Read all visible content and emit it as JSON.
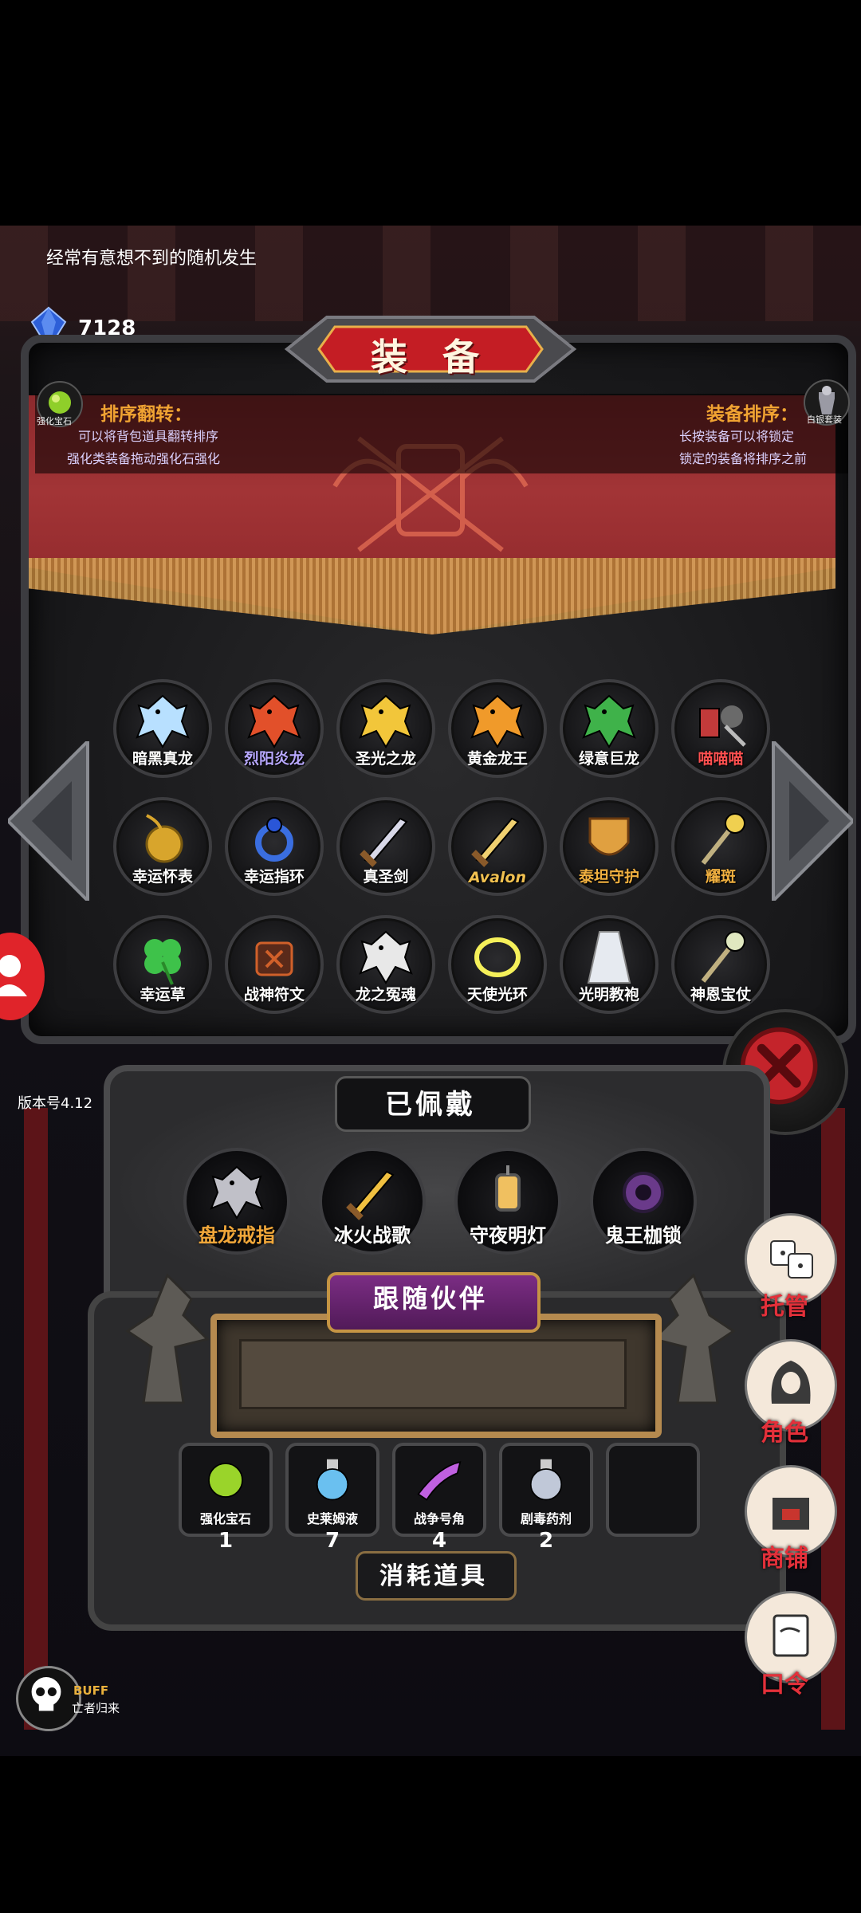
{
  "tip": "经常有意想不到的随机发生",
  "currency": {
    "value": "7128",
    "caption": "宝石"
  },
  "title": "装 备",
  "info": {
    "left_title": "排序翻转：",
    "left_line1": "可以将背包道具翻转排序",
    "left_line2": "强化类装备拖动强化石强化",
    "right_title": "装备排序：",
    "right_line1": "长按装备可以将锁定",
    "right_line2": "锁定的装备将排序之前",
    "left_icon_caption": "强化宝石",
    "right_icon_caption": "白银套装"
  },
  "equipment": [
    {
      "label": "暗黑真龙",
      "icon": "ice-dragon-icon",
      "color": "#b8e0ff"
    },
    {
      "label": "烈阳炎龙",
      "icon": "fire-dragon-icon",
      "color": "#e2502a"
    },
    {
      "label": "圣光之龙",
      "icon": "holy-dragon-icon",
      "color": "#f2c63a"
    },
    {
      "label": "黄金龙王",
      "icon": "gold-dragon-icon",
      "color": "#f09a2a"
    },
    {
      "label": "绿意巨龙",
      "icon": "green-dragon-icon",
      "color": "#3fb24a"
    },
    {
      "label": "喵喵喵",
      "icon": "cat-warrior-icon",
      "color": "#c23a3a"
    },
    {
      "label": "幸运怀表",
      "icon": "pocket-watch-icon",
      "color": "#d8a52c"
    },
    {
      "label": "幸运指环",
      "icon": "ring-icon",
      "color": "#3a6ee0"
    },
    {
      "label": "真圣剑",
      "icon": "holy-sword-icon",
      "color": "#d8d8e8"
    },
    {
      "label": "Avalon",
      "icon": "avalon-sheath-icon",
      "color": "#f0d070"
    },
    {
      "label": "泰坦守护",
      "icon": "titan-shield-icon",
      "color": "#e0a040"
    },
    {
      "label": "耀斑",
      "icon": "flare-mace-icon",
      "color": "#f0d050"
    },
    {
      "label": "幸运草",
      "icon": "clover-icon",
      "color": "#3ec24a"
    },
    {
      "label": "战神符文",
      "icon": "rune-icon",
      "color": "#d0602a"
    },
    {
      "label": "龙之冤魂",
      "icon": "dragon-wraith-icon",
      "color": "#e8e8e8"
    },
    {
      "label": "天使光环",
      "icon": "halo-icon",
      "color": "#f5f05a"
    },
    {
      "label": "光明教袍",
      "icon": "robe-icon",
      "color": "#e6eaf0"
    },
    {
      "label": "神恩宝仗",
      "icon": "holy-staff-icon",
      "color": "#e0e8c0"
    }
  ],
  "worn": {
    "title": "已佩戴",
    "items": [
      {
        "label": "盘龙戒指",
        "icon": "dragon-ring-icon",
        "color": "#c0c0c8",
        "label_color": "#f2a83a"
      },
      {
        "label": "冰火战歌",
        "icon": "ice-fire-sword-icon",
        "color": "#f0c040",
        "label_color": "#ffffff"
      },
      {
        "label": "守夜明灯",
        "icon": "lantern-icon",
        "color": "#f0c060",
        "label_color": "#ffffff"
      },
      {
        "label": "鬼王枷锁",
        "icon": "ghost-chain-icon",
        "color": "#6a3a8a",
        "label_color": "#ffffff"
      }
    ]
  },
  "partner": {
    "title": "跟随伙伴"
  },
  "consumables": {
    "title": "消耗道具",
    "items": [
      {
        "name": "强化宝石",
        "count": "1",
        "icon": "enhance-gem-icon",
        "color": "#9ad42a"
      },
      {
        "name": "史莱姆液",
        "count": "7",
        "icon": "slime-potion-icon",
        "color": "#6ac0f0"
      },
      {
        "name": "战争号角",
        "count": "4",
        "icon": "war-horn-icon",
        "color": "#c060e0"
      },
      {
        "name": "剧毒药剂",
        "count": "2",
        "icon": "poison-potion-icon",
        "color": "#c0c8d8"
      }
    ]
  },
  "version": "版本号4.12",
  "menu": [
    {
      "label": "托管",
      "icon": "dice-icon"
    },
    {
      "label": "角色",
      "icon": "hooded-character-icon"
    },
    {
      "label": "商铺",
      "icon": "shop-icon"
    },
    {
      "label": "口令",
      "icon": "scroll-icon"
    }
  ],
  "buff": {
    "title": "BUFF",
    "subtitle": "亡者归来"
  }
}
